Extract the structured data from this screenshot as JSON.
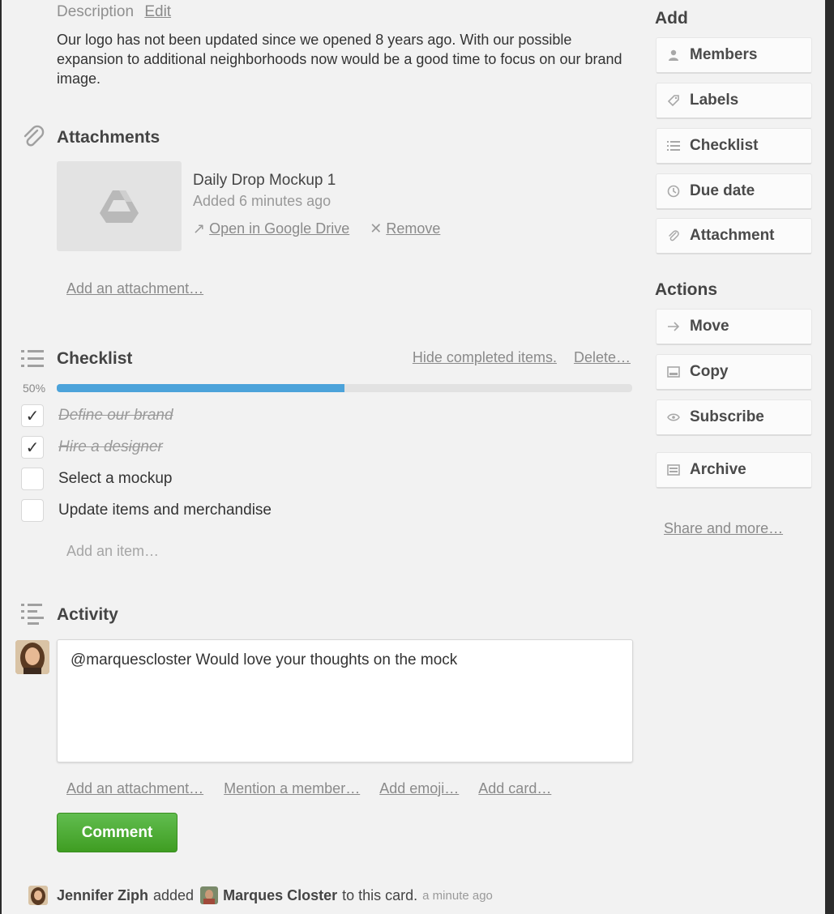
{
  "description": {
    "label": "Description",
    "edit_link": "Edit",
    "text": "Our logo has not been updated since we opened 8 years ago. With our possible expansion to additional neighborhoods now would be a good time to focus on our brand image."
  },
  "attachments": {
    "title": "Attachments",
    "item": {
      "name": "Daily Drop Mockup 1",
      "added": "Added 6 minutes ago",
      "open_link": "Open in Google Drive",
      "remove_link": "Remove",
      "thumbnail_icon": "google-drive-icon"
    },
    "add_link": "Add an attachment…"
  },
  "checklist": {
    "title": "Checklist",
    "hide_link": "Hide completed items.",
    "delete_link": "Delete…",
    "percent_label": "50%",
    "progress": 0.5,
    "items": [
      {
        "text": "Define our brand",
        "checked": true
      },
      {
        "text": "Hire a designer",
        "checked": true
      },
      {
        "text": "Select a mockup",
        "checked": false
      },
      {
        "text": "Update items and merchandise",
        "checked": false
      }
    ],
    "add_item": "Add an item…"
  },
  "activity": {
    "title": "Activity",
    "comment_value": "@marquescloster Would love your thoughts on the mock",
    "links": {
      "attachment": "Add an attachment…",
      "mention": "Mention a member…",
      "emoji": "Add emoji…",
      "card": "Add card…"
    },
    "comment_button": "Comment",
    "log": {
      "actor": "Jennifer Ziph",
      "verb": "added",
      "target": "Marques Closter",
      "suffix": "to this card.",
      "time": "a minute ago"
    }
  },
  "sidebar": {
    "add_heading": "Add",
    "add_buttons": {
      "members": "Members",
      "labels": "Labels",
      "checklist": "Checklist",
      "due_date": "Due date",
      "attachment": "Attachment"
    },
    "actions_heading": "Actions",
    "action_buttons": {
      "move": "Move",
      "copy": "Copy",
      "subscribe": "Subscribe",
      "archive": "Archive"
    },
    "share_link": "Share and more…"
  },
  "colors": {
    "progress": "#4ca3da",
    "comment_button": "#4fae31",
    "background": "#f2f2f2"
  }
}
